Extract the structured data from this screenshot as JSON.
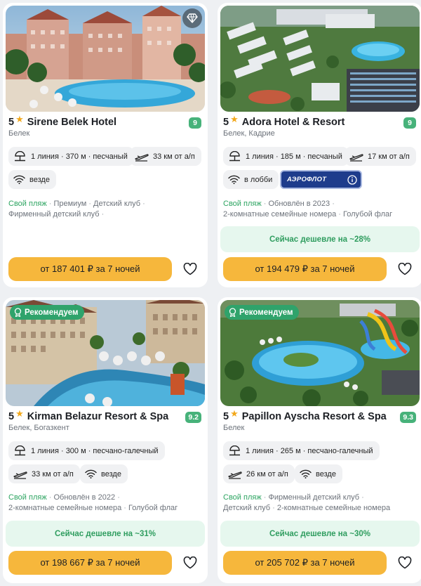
{
  "cards": [
    {
      "stars": "5",
      "name": "Sirene Belek Hotel",
      "rating": "9",
      "location": "Белек",
      "beach_chip": "1 линия · 370 м · песчаный",
      "airport_chip": "33 км от а/п",
      "wifi_chip": "везде",
      "features": [
        {
          "text": "Свой пляж",
          "highlight": true
        },
        {
          "text": "Премиум",
          "highlight": false
        },
        {
          "text": "Детский клуб",
          "highlight": false
        },
        {
          "text": "Фирменный детский клуб",
          "highlight": false
        }
      ],
      "price": "от 187 401 ₽ за 7 ночей",
      "has_diamond": true,
      "photo_icon": "hotel-pool-photo"
    },
    {
      "stars": "5",
      "name": "Adora Hotel & Resort",
      "rating": "9",
      "location": "Белек, Кадрие",
      "beach_chip": "1 линия · 185 м · песчаный",
      "airport_chip": "17 км от а/п",
      "wifi_chip": "в лобби",
      "partner": "АЭРОФЛОТ",
      "features": [
        {
          "text": "Свой пляж",
          "highlight": true
        },
        {
          "text": "Обновлён в 2023",
          "highlight": false
        },
        {
          "text": "2-комнатные семейные номера",
          "highlight": false
        },
        {
          "text": "Голубой флаг",
          "highlight": false
        }
      ],
      "deal": "Сейчас дешевле на ~28%",
      "price": "от 194 479 ₽ за 7 ночей",
      "photo_icon": "resort-aerial-photo"
    },
    {
      "badge": "Рекомендуем",
      "stars": "5",
      "name": "Kirman Belazur Resort & Spa",
      "rating": "9.2",
      "location": "Белек, Богазкент",
      "beach_chip": "1 линия · 300 м · песчано-галечный",
      "airport_chip": "33 км от а/п",
      "wifi_chip": "везде",
      "features": [
        {
          "text": "Свой пляж",
          "highlight": true
        },
        {
          "text": "Обновлён в 2022",
          "highlight": false
        },
        {
          "text": "2-комнатные семейные номера",
          "highlight": false
        },
        {
          "text": "Голубой флаг",
          "highlight": false
        }
      ],
      "deal": "Сейчас дешевле на ~31%",
      "price": "от 198 667 ₽ за 7 ночей",
      "photo_icon": "resort-pool-photo"
    },
    {
      "badge": "Рекомендуем",
      "stars": "5",
      "name": "Papillon Ayscha Resort & Spa",
      "rating": "9.3",
      "location": "Белек",
      "beach_chip": "1 линия · 265 м · песчано-галечный",
      "airport_chip": "26 км от а/п",
      "wifi_chip": "везде",
      "features": [
        {
          "text": "Свой пляж",
          "highlight": true
        },
        {
          "text": "Фирменный детский клуб",
          "highlight": false
        },
        {
          "text": "Детский клуб",
          "highlight": false
        },
        {
          "text": "2-комнатные семейные номера",
          "highlight": false
        }
      ],
      "deal": "Сейчас дешевле на ~30%",
      "price": "от 205 702 ₽ за 7 ночей",
      "photo_icon": "waterpark-aerial-photo"
    }
  ],
  "colors": {
    "accent_button": "#f6b73c",
    "rating_green": "#47b27a",
    "feature_green": "#2ea562",
    "deal_bg": "#e6f7ee",
    "recommend_badge": "#2fa36b",
    "aeroflot_blue": "#1e3c8c"
  }
}
